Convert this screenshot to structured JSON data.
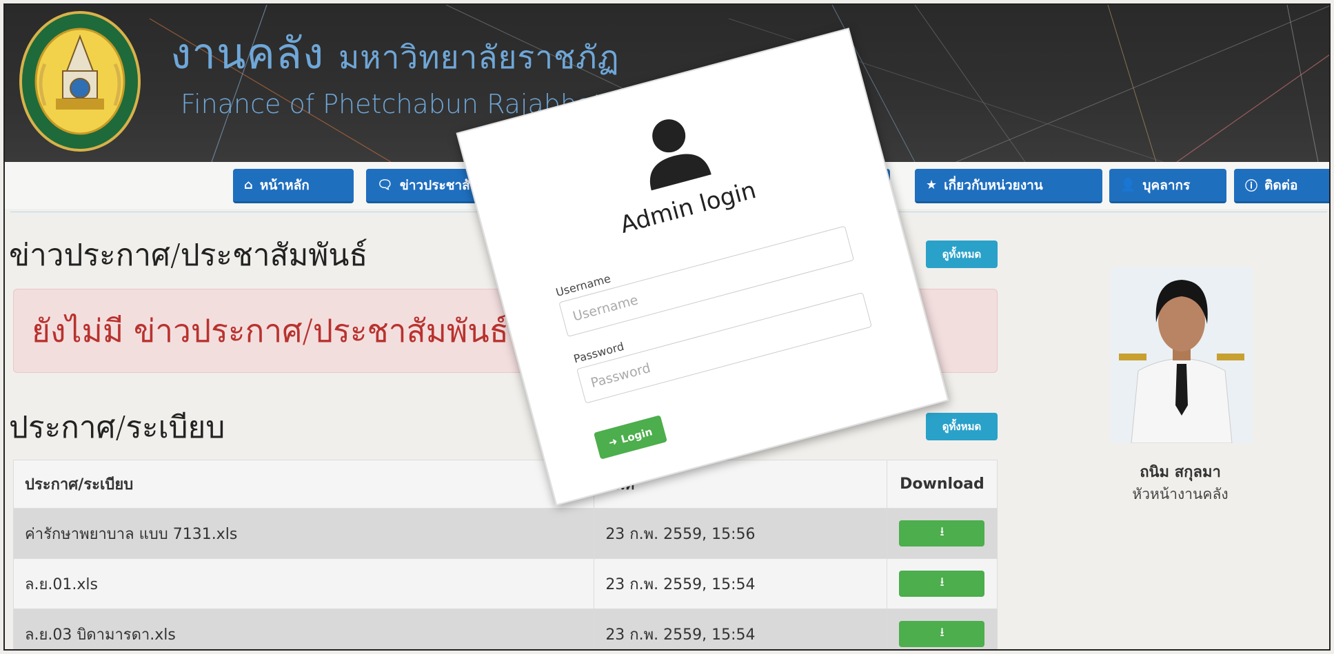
{
  "header": {
    "title_th": "งานคลัง",
    "subtitle_th": "มหาวิทยาลัยราชภัฏ",
    "title_en": "Finance of Phetchabun Rajabhat"
  },
  "nav": {
    "items": [
      {
        "icon": "home-icon",
        "label": "หน้าหลัก"
      },
      {
        "icon": "chat-icon",
        "label": "ข่าวประชาสั"
      },
      {
        "icon": "star-icon",
        "label": "เกี่ยวกับหน่วยงาน"
      },
      {
        "icon": "user-icon",
        "label": "บุคลากร"
      },
      {
        "icon": "info-icon",
        "label": "ติดต่อ"
      }
    ]
  },
  "news": {
    "title": "ข่าวประกาศ/ประชาสัมพันธ์",
    "more_label": "ดูทั้งหมด",
    "empty_message": "ยังไม่มี ข่าวประกาศ/ประชาสัมพันธ์"
  },
  "regulations": {
    "title": "ประกาศ/ระเบียบ",
    "more_label": "ดูทั้งหมด",
    "columns": [
      "ประกาศ/ระเบียบ",
      "วันที่",
      "Download"
    ],
    "rows": [
      {
        "name": "ค่ารักษาพยาบาล แบบ 7131.xls",
        "date": "23 ก.พ. 2559, 15:56"
      },
      {
        "name": "ล.ย.01.xls",
        "date": "23 ก.พ. 2559, 15:54"
      },
      {
        "name": "ล.ย.03 บิดามารดา.xls",
        "date": "23 ก.พ. 2559, 15:54"
      }
    ]
  },
  "profile": {
    "name": "ถนิม สกุลมา",
    "role": "หัวหน้างานคลัง"
  },
  "login": {
    "title": "Admin login",
    "username_label": "Username",
    "username_placeholder": "Username",
    "password_label": "Password",
    "password_placeholder": "Password",
    "button_label": "Login"
  },
  "colors": {
    "nav": "#1f6fbf",
    "info": "#2aa1c9",
    "success": "#4cae4c",
    "alert_text": "#b8322e",
    "header_text": "#6fa7d8"
  }
}
